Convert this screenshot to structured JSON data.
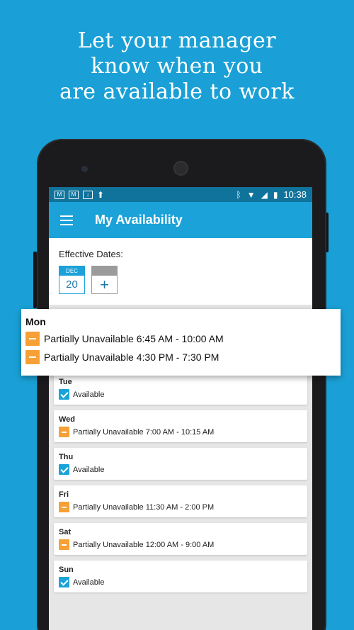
{
  "headline": [
    "Let your manager",
    "know when you",
    "are available to work"
  ],
  "statusbar": {
    "time": "10:38"
  },
  "appbar": {
    "title": "My Availability"
  },
  "dates": {
    "label": "Effective Dates:",
    "selected": {
      "month": "DEC",
      "day": "20"
    },
    "add_label": "+"
  },
  "mon": {
    "day": "Mon",
    "entries": [
      "Partially Unavailable 6:45 AM - 10:00 AM",
      "Partially Unavailable 4:30 PM - 7:30 PM"
    ]
  },
  "days": [
    {
      "day": "Tue",
      "status": "available",
      "text": "Available"
    },
    {
      "day": "Wed",
      "status": "partial",
      "text": "Partially Unavailable 7:00 AM - 10:15 AM"
    },
    {
      "day": "Thu",
      "status": "available",
      "text": "Available"
    },
    {
      "day": "Fri",
      "status": "partial",
      "text": "Partially Unavailable 11:30 AM - 2:00 PM"
    },
    {
      "day": "Sat",
      "status": "partial",
      "text": "Partially Unavailable 12:00 AM - 9:00 AM"
    },
    {
      "day": "Sun",
      "status": "available",
      "text": "Available"
    }
  ],
  "colors": {
    "background": "#1aa0d6",
    "appbar": "#1ba2d9",
    "statusbar": "#10739b",
    "partial": "#f7a035"
  }
}
